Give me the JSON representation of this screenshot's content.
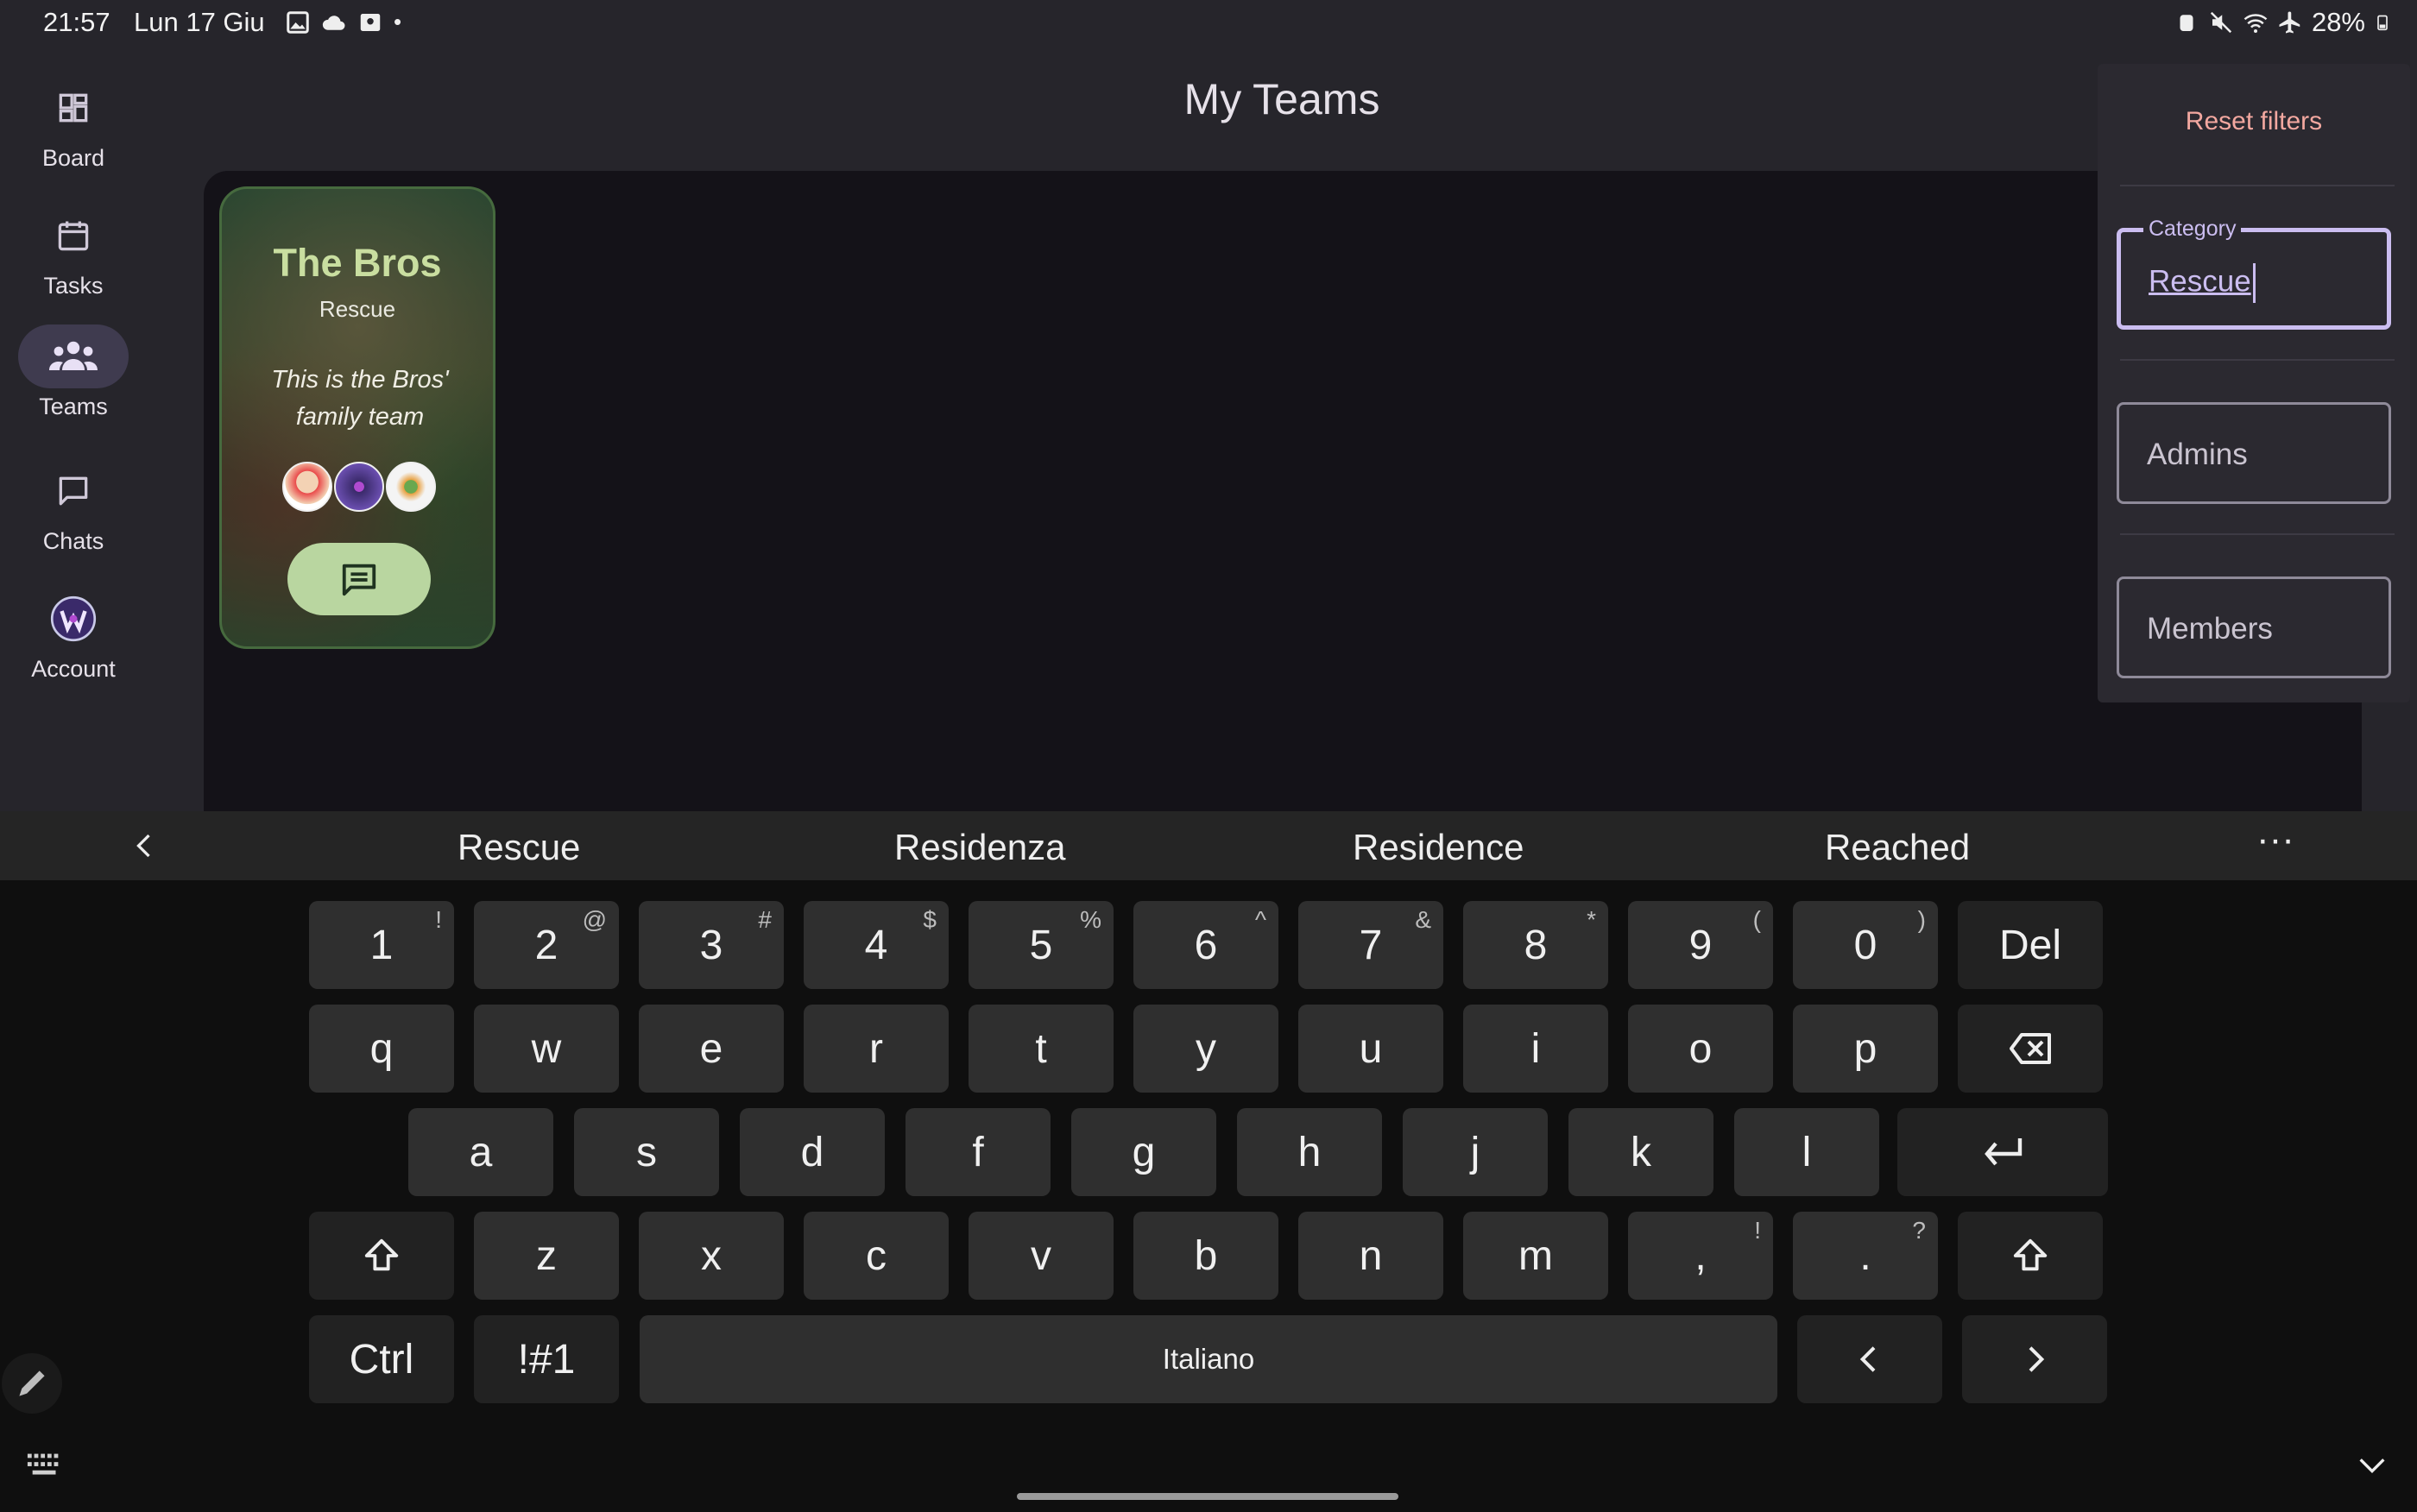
{
  "status_bar": {
    "time": "21:57",
    "date": "Lun 17 Giu",
    "battery": "28%"
  },
  "nav": {
    "items": [
      {
        "label": "Board",
        "icon": "board-icon",
        "active": false
      },
      {
        "label": "Tasks",
        "icon": "calendar-icon",
        "active": false
      },
      {
        "label": "Teams",
        "icon": "teams-icon",
        "active": true
      },
      {
        "label": "Chats",
        "icon": "chat-icon",
        "active": false
      },
      {
        "label": "Account",
        "icon": "avatar-icon",
        "active": false
      }
    ]
  },
  "page": {
    "title": "My Teams"
  },
  "team_card": {
    "name": "The Bros",
    "category": "Rescue",
    "description": "This is the Bros' family team",
    "member_count": 3
  },
  "filters": {
    "reset_label": "Reset filters",
    "category_label": "Category",
    "category_value": "Rescue",
    "admins_placeholder": "Admins",
    "members_placeholder": "Members"
  },
  "keyboard": {
    "suggestions": [
      "Rescue",
      "Residenza",
      "Residence",
      "Reached"
    ],
    "row_numbers": [
      {
        "k": "1",
        "s": "!"
      },
      {
        "k": "2",
        "s": "@"
      },
      {
        "k": "3",
        "s": "#"
      },
      {
        "k": "4",
        "s": "$"
      },
      {
        "k": "5",
        "s": "%"
      },
      {
        "k": "6",
        "s": "^"
      },
      {
        "k": "7",
        "s": "&"
      },
      {
        "k": "8",
        "s": "*"
      },
      {
        "k": "9",
        "s": "("
      },
      {
        "k": "0",
        "s": ")"
      }
    ],
    "del_label": "Del",
    "row_q": [
      "q",
      "w",
      "e",
      "r",
      "t",
      "y",
      "u",
      "i",
      "o",
      "p"
    ],
    "row_a": [
      "a",
      "s",
      "d",
      "f",
      "g",
      "h",
      "j",
      "k",
      "l"
    ],
    "row_z": [
      "z",
      "x",
      "c",
      "v",
      "b",
      "n",
      "m"
    ],
    "comma": {
      "k": ",",
      "s": "!"
    },
    "period": {
      "k": ".",
      "s": "?"
    },
    "ctrl_label": "Ctrl",
    "symbols_label": "!#1",
    "space_label": "Italiano",
    "colors": {
      "key": "#2f2f2f",
      "background": "#0f0f0f"
    }
  }
}
